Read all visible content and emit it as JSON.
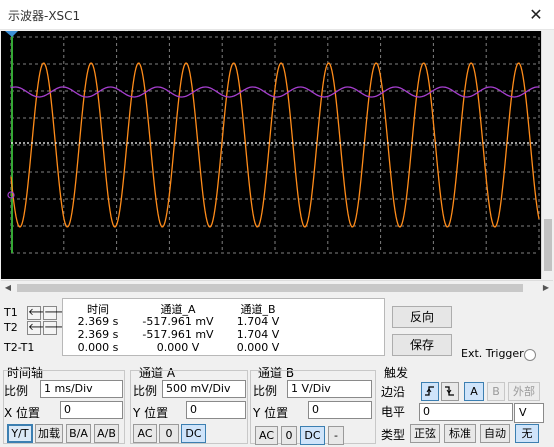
{
  "window": {
    "title": "示波器-XSC1",
    "close_glyph": "✕"
  },
  "measurement": {
    "row_labels": [
      "T1",
      "T2",
      "T2-T1"
    ],
    "headers": [
      "时间",
      "通道_A",
      "通道_B"
    ],
    "rows": [
      [
        "2.369 s",
        "-517.961 mV",
        "1.704 V"
      ],
      [
        "2.369 s",
        "-517.961 mV",
        "1.704 V"
      ],
      [
        "0.000 s",
        "0.000 V",
        "0.000 V"
      ]
    ]
  },
  "buttons": {
    "reverse": "反向",
    "save": "保存"
  },
  "ext_trigger": "Ext. Trigger",
  "timebase": {
    "title": "时间轴",
    "scale_label": "比例",
    "scale_value": "1 ms/Div",
    "xpos_label": "X 位置",
    "xpos_value": "0",
    "modes": [
      "Y/T",
      "加载",
      "B/A",
      "A/B"
    ]
  },
  "channel_a": {
    "title": "通道 A",
    "scale_label": "比例",
    "scale_value": "500 mV/Div",
    "ypos_label": "Y 位置",
    "ypos_value": "0",
    "coupling": [
      "AC",
      "0",
      "DC"
    ]
  },
  "channel_b": {
    "title": "通道 B",
    "scale_label": "比例",
    "scale_value": "1 V/Div",
    "ypos_label": "Y 位置",
    "ypos_value": "0",
    "coupling": [
      "AC",
      "0",
      "DC"
    ],
    "coupling_extra": "-"
  },
  "trigger": {
    "title": "触发",
    "edge_label": "边沿",
    "edge_buttons": [
      "A",
      "B",
      "外部"
    ],
    "level_label": "电平",
    "level_value": "0",
    "level_unit": "V",
    "type_label": "类型",
    "types": [
      "正弦",
      "标准",
      "自动",
      "无"
    ]
  },
  "colors": {
    "screen_bg": "#000000",
    "grid": "#7f7f7f",
    "trace_a": "#ff8c1a",
    "trace_b": "#a63fcf",
    "trace_mid": "#ffffff"
  },
  "icons": {
    "close": "close-icon",
    "arrow_left": "arrow-left-icon",
    "arrow_right": "arrow-right-icon",
    "rising_edge": "rising-edge-icon",
    "falling_edge": "falling-edge-icon",
    "dropdown": "chevron-down-icon"
  }
}
